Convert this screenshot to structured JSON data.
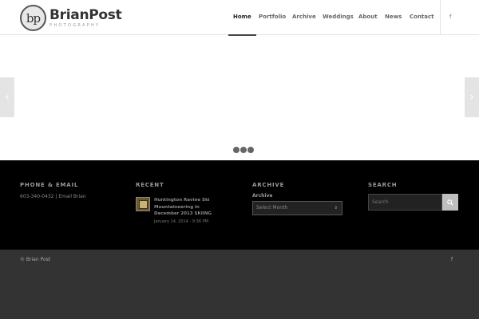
{
  "logo": {
    "mark": "bp",
    "name": "BrianPost",
    "tagline": "PHOTOGRAPHY"
  },
  "nav": {
    "items": [
      {
        "label": "Home",
        "active": true
      },
      {
        "label": "Portfolio"
      },
      {
        "label": "Archive"
      },
      {
        "label": "Weddings"
      },
      {
        "label": "About"
      },
      {
        "label": "News"
      },
      {
        "label": "Contact"
      }
    ],
    "social": "f"
  },
  "slider": {
    "prev_icon": "chevron-left-icon",
    "next_icon": "chevron-right-icon",
    "dots_count": 3
  },
  "footer": {
    "phone": {
      "heading": "PHONE & EMAIL",
      "text": "603-340-0432 | Email Brian"
    },
    "recent": {
      "heading": "RECENT",
      "post_title": "Huntington Ravine Ski Mountaineering in December 2013 SKIING",
      "post_date": "January 14, 2014 - 9:36 PM"
    },
    "archive": {
      "heading": "ARCHIVE",
      "label": "Archive",
      "select_value": "Select Month"
    },
    "search": {
      "heading": "SEARCH",
      "placeholder": "Search"
    }
  },
  "socket": {
    "copyright": "© Brian Post",
    "social": "f"
  },
  "colors": {
    "footer_bg": "#000000",
    "socket_bg": "#333333",
    "accent": "#444444"
  }
}
